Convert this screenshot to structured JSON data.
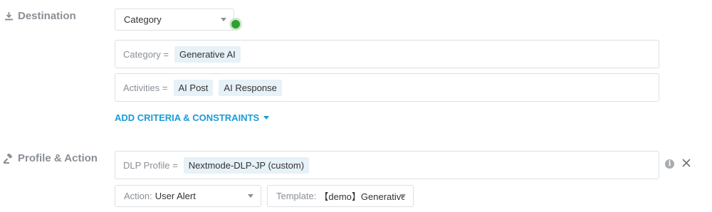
{
  "destination": {
    "label": "Destination",
    "icon": "download-icon",
    "select_value": "Category",
    "status_color": "#2ea12e",
    "criteria": [
      {
        "label": "Category =",
        "chips": [
          "Generative AI"
        ]
      },
      {
        "label": "Activities =",
        "chips": [
          "AI Post",
          "AI Response"
        ]
      }
    ],
    "add_criteria_label": "ADD CRITERIA & CONSTRAINTS"
  },
  "profile_action": {
    "label": "Profile & Action",
    "icon": "gavel-icon",
    "dlp_profile_label": "DLP Profile =",
    "dlp_profile_value": "Nextmode-DLP-JP (custom)",
    "action_label": "Action:",
    "action_value": "User Alert",
    "template_label": "Template:",
    "template_value": "【demo】Generative"
  },
  "colors": {
    "accent": "#1a9bd7",
    "chip_bg": "#e6f1f8",
    "label_gray": "#8a8f95"
  }
}
